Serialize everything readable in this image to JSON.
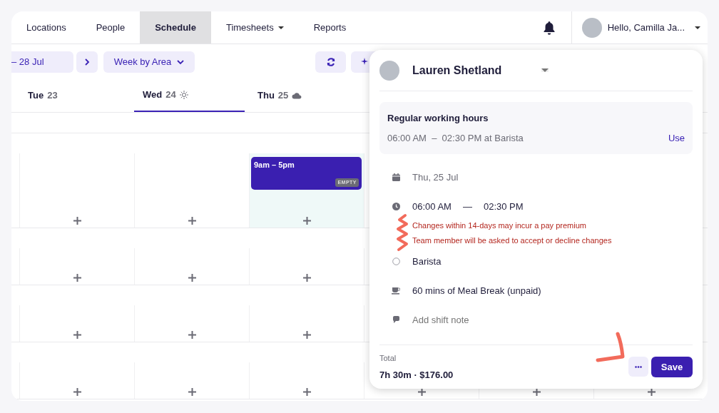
{
  "nav": {
    "items": [
      {
        "label": "Locations",
        "selected": false,
        "dropdown": false
      },
      {
        "label": "People",
        "selected": false,
        "dropdown": false
      },
      {
        "label": "Schedule",
        "selected": true,
        "dropdown": false
      },
      {
        "label": "Timesheets",
        "selected": false,
        "dropdown": true
      },
      {
        "label": "Reports",
        "selected": false,
        "dropdown": false
      }
    ],
    "greeting": "Hello, Camilla Ja..."
  },
  "toolbar": {
    "date_range": "– 28 Jul",
    "view": "Week by Area"
  },
  "days": [
    {
      "name": "Tue",
      "date": "23",
      "selected": false,
      "kind": "plain"
    },
    {
      "name": "Wed",
      "date": "24",
      "selected": true,
      "kind": "sun"
    },
    {
      "name": "Thu",
      "date": "25",
      "selected": false,
      "kind": "cloud"
    }
  ],
  "grid": {
    "rows": [
      {
        "cells": [
          {
            "highlighted": false
          },
          {
            "highlighted": false
          },
          {
            "highlighted": true,
            "shift": {
              "time": "9am – 5pm",
              "badge": "EMPTY"
            }
          },
          {
            "highlighted": false
          }
        ]
      },
      {
        "cells": [
          {
            "highlighted": false
          },
          {
            "highlighted": false
          },
          {
            "highlighted": false
          },
          {
            "highlighted": false
          }
        ]
      },
      {
        "cells": [
          {
            "highlighted": false
          },
          {
            "highlighted": false
          },
          {
            "highlighted": false
          },
          {
            "highlighted": false
          }
        ]
      },
      {
        "cells": [
          {
            "highlighted": false
          },
          {
            "highlighted": false
          },
          {
            "highlighted": false
          },
          {
            "highlighted": false
          },
          {
            "highlighted": false
          },
          {
            "highlighted": false
          }
        ]
      }
    ]
  },
  "shift_popup": {
    "employee": "Lauren Shetland",
    "regular_hours": {
      "title": "Regular working hours",
      "hours": "06:00 AM  –  02:30 PM at Barista",
      "action": "Use"
    },
    "date": "Thu, 25 Jul",
    "start": "06:00 AM",
    "separator": "—",
    "end": "02:30 PM",
    "warnings": [
      "Changes within 14-days may incur a pay premium",
      "Team member will be asked to accept or decline changes"
    ],
    "area": "Barista",
    "meal_break": "60 mins of Meal Break (unpaid)",
    "note": {
      "placeholder": "Add shift note"
    },
    "total_label": "Total",
    "total": "7h 30m · $176.00",
    "save": "Save"
  }
}
